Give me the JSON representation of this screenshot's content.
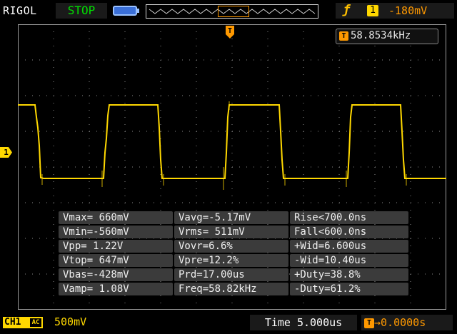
{
  "header": {
    "brand": "RIGOL",
    "run_state": "STOP",
    "trigger_source": "1",
    "trigger_level": "-180mV",
    "trigger_marker": "T"
  },
  "screen": {
    "frequency_counter_icon": "T",
    "frequency_counter": "58.8534kHz",
    "channel_marker": "1"
  },
  "measurements": [
    [
      "Vmax= 660mV",
      "Vavg=-5.17mV",
      "Rise<700.0ns"
    ],
    [
      "Vmin=-560mV",
      "Vrms= 511mV",
      "Fall<600.0ns"
    ],
    [
      "Vpp= 1.22V",
      "Vovr=6.6%",
      "+Wid=6.600us"
    ],
    [
      "Vtop= 647mV",
      "Vpre=12.2%",
      "-Wid=10.40us"
    ],
    [
      "Vbas=-428mV",
      "Prd=17.00us",
      "+Duty=38.8%"
    ],
    [
      "Vamp= 1.08V",
      "Freq=58.82kHz",
      "-Duty=61.2%"
    ]
  ],
  "footer": {
    "channel_label": "CH1",
    "coupling": "AC",
    "vertical_scale": "500mV",
    "timebase": "Time 5.000us",
    "trigger_position_icon": "T",
    "trigger_position": "0.0000s"
  },
  "colors": {
    "trace": "#ffd800",
    "trigger": "#ff9900",
    "grid": "#8a8a8a",
    "run_state": "#00e000"
  },
  "icons": [
    "usb-icon",
    "trigger-edge-rising-icon",
    "memory-depth-bar"
  ]
}
